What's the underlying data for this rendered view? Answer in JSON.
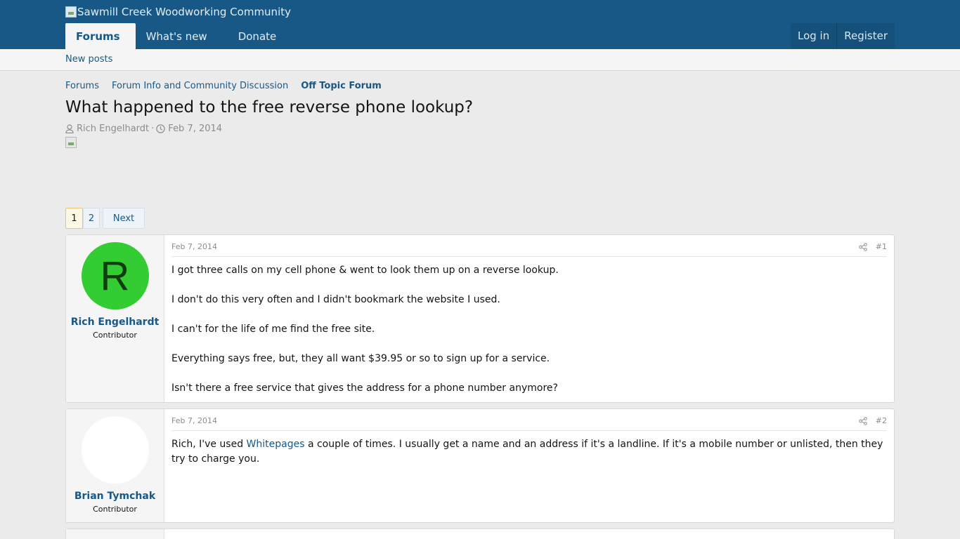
{
  "header": {
    "logo_alt": "Sawmill Creek Woodworking Community",
    "nav": [
      "Forums",
      "What's new",
      "Donate"
    ],
    "login": "Log in",
    "register": "Register"
  },
  "subnav": {
    "new_posts": "New posts"
  },
  "breadcrumb": [
    "Forums",
    "Forum Info and Community Discussion",
    "Off Topic Forum"
  ],
  "thread": {
    "title": "What happened to the free reverse phone lookup?",
    "author": "Rich Engelhardt",
    "date": "Feb 7, 2014"
  },
  "pager": {
    "current": "1",
    "page2": "2",
    "next": "Next"
  },
  "posts": [
    {
      "avatar_letter": "R",
      "username": "Rich Engelhardt",
      "title": "Contributor",
      "date": "Feb 7, 2014",
      "number": "#1",
      "paragraphs": [
        "I got three calls on my cell phone & went to look them up on a reverse lookup.",
        "I don't do this very often and I didn't bookmark the website I used.",
        "I can't for the life of me find the free site.",
        "Everything says free, but, they all want $39.95 or so to sign up for a service.",
        "Isn't there a free service that gives the address for a phone number anymore?"
      ]
    },
    {
      "username": "Brian Tymchak",
      "title": "Contributor",
      "date": "Feb 7, 2014",
      "number": "#2",
      "text_before": "Rich, I've used ",
      "link": "Whitepages",
      "text_after": " a couple of times. I usually get a name and an address if it's a landline. If it's a mobile number or unlisted, then they try to charge you."
    }
  ],
  "colors": {
    "header_bg": "#185886",
    "link": "#185886",
    "avatar_green": "#33cc33"
  }
}
